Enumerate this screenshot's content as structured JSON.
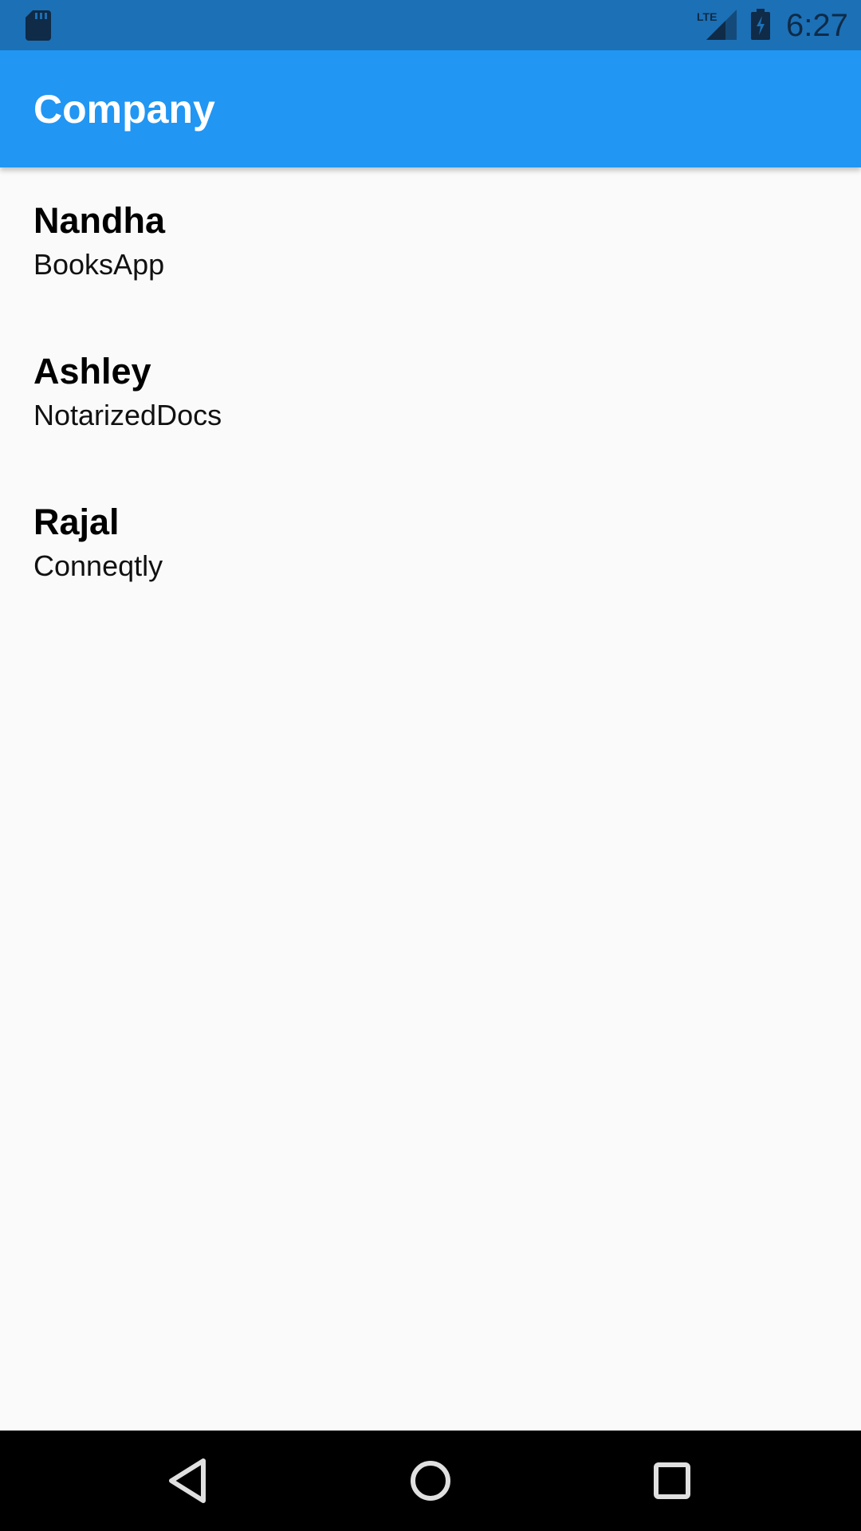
{
  "status_bar": {
    "time": "6:27",
    "network_label": "LTE",
    "icons": [
      "sd-card-icon",
      "lte-signal-icon",
      "battery-charging-icon"
    ]
  },
  "app_bar": {
    "title": "Company",
    "color": "#2196f3"
  },
  "list": {
    "items": [
      {
        "name": "Nandha",
        "company": "BooksApp"
      },
      {
        "name": "Ashley",
        "company": "NotarizedDocs"
      },
      {
        "name": "Rajal",
        "company": "Conneqtly"
      }
    ]
  },
  "nav_bar": {
    "icons": [
      "back-icon",
      "home-icon",
      "recents-icon"
    ]
  }
}
